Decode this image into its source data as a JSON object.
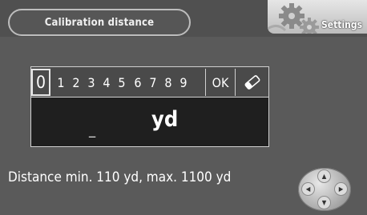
{
  "header": {
    "title": "Calibration distance",
    "settings_label": "Settings"
  },
  "keypad": {
    "selected": "0",
    "digits": [
      "1",
      "2",
      "3",
      "4",
      "5",
      "6",
      "7",
      "8",
      "9"
    ],
    "ok_label": "OK",
    "erase_icon": "eraser-icon"
  },
  "display": {
    "cursor": "_",
    "unit": "yd"
  },
  "info": {
    "text": "Distance min. 110 yd, max. 1100 yd"
  },
  "nav": {
    "icon": "directional-pad-icon",
    "up": "▲",
    "down": "▼",
    "left": "◀",
    "right": "▶"
  },
  "colors": {
    "background": "#5a5a5a",
    "display_bg": "#1f1f1f",
    "border": "#d0d0d0"
  }
}
